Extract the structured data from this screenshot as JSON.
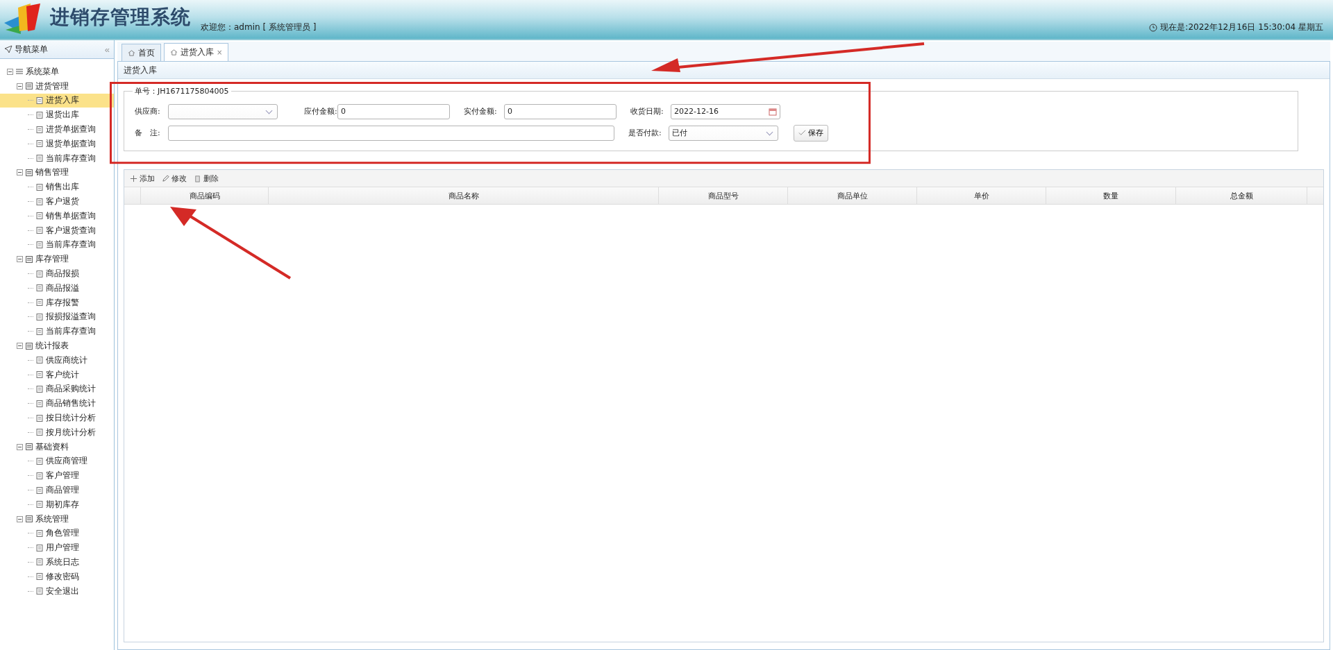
{
  "header": {
    "title": "进销存管理系统",
    "welcome": "欢迎您：admin [ 系统管理员 ]",
    "clock": "现在是:2022年12月16日 15:30:04 星期五"
  },
  "sidebar": {
    "title": "导航菜单",
    "collapse": "«",
    "tree": [
      {
        "label": "系统菜单",
        "expanded": true,
        "children": [
          {
            "label": "进货管理",
            "expanded": true,
            "children": [
              {
                "label": "进货入库",
                "selected": true
              },
              {
                "label": "退货出库",
                "selected": false
              },
              {
                "label": "进货单据查询",
                "selected": false
              },
              {
                "label": "退货单据查询",
                "selected": false
              },
              {
                "label": "当前库存查询",
                "selected": false
              }
            ]
          },
          {
            "label": "销售管理",
            "expanded": true,
            "children": [
              {
                "label": "销售出库",
                "selected": false
              },
              {
                "label": "客户退货",
                "selected": false
              },
              {
                "label": "销售单据查询",
                "selected": false
              },
              {
                "label": "客户退货查询",
                "selected": false
              },
              {
                "label": "当前库存查询",
                "selected": false
              }
            ]
          },
          {
            "label": "库存管理",
            "expanded": true,
            "children": [
              {
                "label": "商品报损",
                "selected": false
              },
              {
                "label": "商品报溢",
                "selected": false
              },
              {
                "label": "库存报警",
                "selected": false
              },
              {
                "label": "报损报溢查询",
                "selected": false
              },
              {
                "label": "当前库存查询",
                "selected": false
              }
            ]
          },
          {
            "label": "统计报表",
            "expanded": true,
            "children": [
              {
                "label": "供应商统计",
                "selected": false
              },
              {
                "label": "客户统计",
                "selected": false
              },
              {
                "label": "商品采购统计",
                "selected": false
              },
              {
                "label": "商品销售统计",
                "selected": false
              },
              {
                "label": "按日统计分析",
                "selected": false
              },
              {
                "label": "按月统计分析",
                "selected": false
              }
            ]
          },
          {
            "label": "基础资料",
            "expanded": true,
            "children": [
              {
                "label": "供应商管理",
                "selected": false
              },
              {
                "label": "客户管理",
                "selected": false
              },
              {
                "label": "商品管理",
                "selected": false
              },
              {
                "label": "期初库存",
                "selected": false
              }
            ]
          },
          {
            "label": "系统管理",
            "expanded": true,
            "children": [
              {
                "label": "角色管理",
                "selected": false
              },
              {
                "label": "用户管理",
                "selected": false
              },
              {
                "label": "系统日志",
                "selected": false
              },
              {
                "label": "修改密码",
                "selected": false
              },
              {
                "label": "安全退出",
                "selected": false
              }
            ]
          }
        ]
      }
    ]
  },
  "tabs": [
    {
      "label": "首页",
      "selected": false,
      "closable": false
    },
    {
      "label": "进货入库",
      "selected": true,
      "closable": true
    }
  ],
  "tab_close": "×",
  "panel": {
    "title": "进货入库",
    "order_no": "单号：JH1671175804005",
    "fields": {
      "supplier": {
        "label": "供应商:"
      },
      "payable": {
        "label": "应付金额:",
        "value": "0"
      },
      "paid": {
        "label": "实付金额:",
        "value": "0"
      },
      "date": {
        "label": "收货日期:",
        "value": "2022-12-16"
      },
      "remark": {
        "label": "备　注:"
      },
      "pay_status": {
        "label": "是否付款:",
        "value": "已付"
      }
    },
    "save": "保存"
  },
  "toolbar": [
    {
      "kind": "add",
      "label": "添加"
    },
    {
      "kind": "edit",
      "label": "修改"
    },
    {
      "kind": "delete",
      "label": "删除"
    }
  ],
  "table": {
    "columns": [
      "商品编码",
      "商品名称",
      "商品型号",
      "商品单位",
      "单价",
      "数量",
      "总金额"
    ]
  }
}
